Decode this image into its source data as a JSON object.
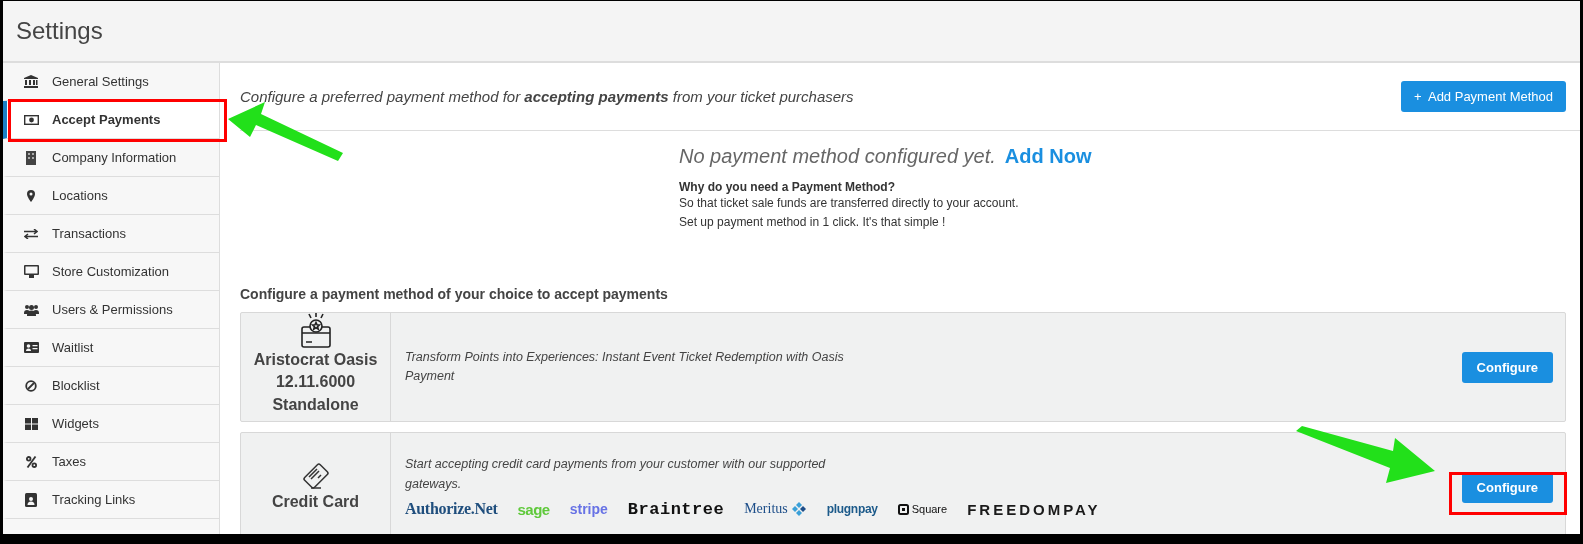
{
  "header": {
    "title": "Settings"
  },
  "sidebar": {
    "items": [
      {
        "label": "General Settings",
        "selected": false
      },
      {
        "label": "Accept Payments",
        "selected": true
      },
      {
        "label": "Company Information",
        "selected": false
      },
      {
        "label": "Locations",
        "selected": false
      },
      {
        "label": "Transactions",
        "selected": false
      },
      {
        "label": "Store Customization",
        "selected": false
      },
      {
        "label": "Users & Permissions",
        "selected": false
      },
      {
        "label": "Waitlist",
        "selected": false
      },
      {
        "label": "Blocklist",
        "selected": false
      },
      {
        "label": "Widgets",
        "selected": false
      },
      {
        "label": "Taxes",
        "selected": false
      },
      {
        "label": "Tracking Links",
        "selected": false
      }
    ]
  },
  "intro": {
    "text": "Configure a preferred payment method for **accepting payments** from your ticket purchasers",
    "button": "+  Add Payment Method"
  },
  "empty_state": {
    "message": "No payment method configured yet.",
    "link": "Add Now",
    "question": "Why do you need a Payment Method?",
    "lines": [
      "So that ticket sale funds are transferred directly to your account.",
      "Set up payment method in 1 click. It's that simple !"
    ]
  },
  "section_title": "Configure a payment method of your choice to accept payments",
  "cards": [
    {
      "kind": "oasis",
      "name": "Aristocrat Oasis 12.11.6000 Standalone",
      "description": "Transform Points into Experiences: Instant Event Ticket Redemption with Oasis Payment",
      "button": "Configure"
    },
    {
      "kind": "card",
      "name": "Credit Card",
      "description": "Start accepting credit card payments from your customer with our supported gateways.",
      "button": "Configure",
      "gateways": [
        {
          "name": "Authorize.Net",
          "color": "#1f4e7d"
        },
        {
          "name": "sage",
          "color": "#5fc93b"
        },
        {
          "name": "stripe",
          "color": "#6772e5"
        },
        {
          "name": "Braintree",
          "color": "#111111"
        },
        {
          "name": "Meritus",
          "color": "#1d4e89"
        },
        {
          "name": "plugnpay",
          "color": "#1c5a8a"
        },
        {
          "name": "Square",
          "color": "#111111"
        },
        {
          "name": "FREEDOMPAY",
          "color": "#1a1a1a"
        }
      ]
    }
  ]
}
